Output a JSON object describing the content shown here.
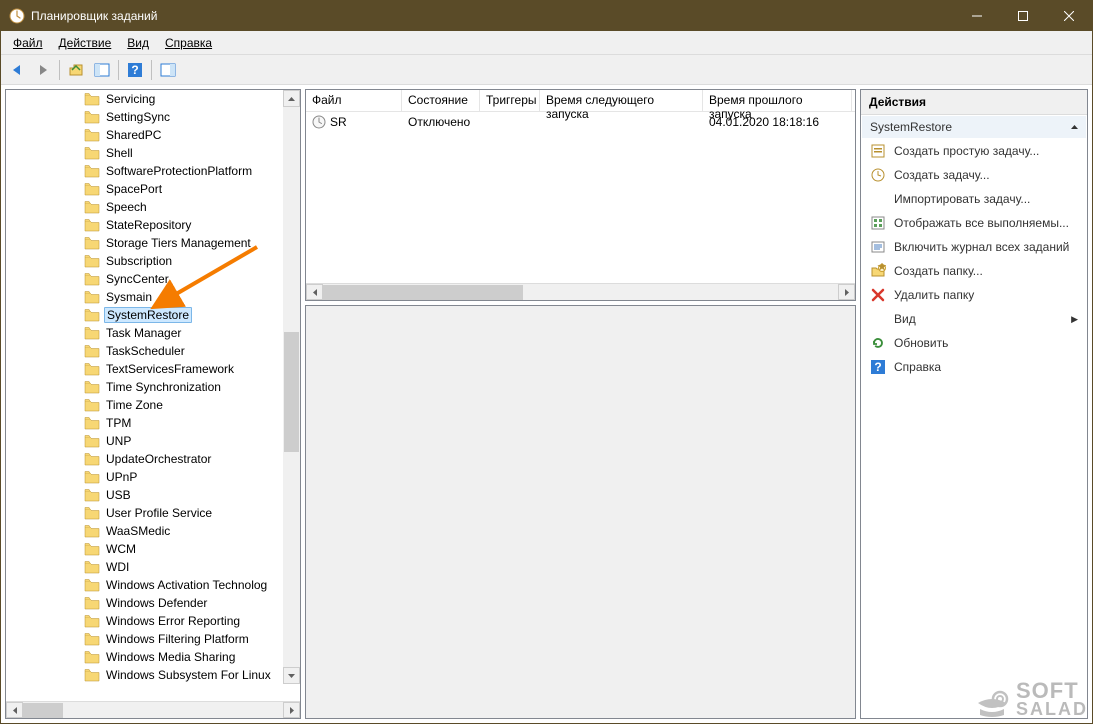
{
  "window": {
    "title": "Планировщик заданий"
  },
  "menu": {
    "items": [
      "Файл",
      "Действие",
      "Вид",
      "Справка"
    ]
  },
  "tree": {
    "items": [
      {
        "label": "Servicing"
      },
      {
        "label": "SettingSync"
      },
      {
        "label": "SharedPC"
      },
      {
        "label": "Shell"
      },
      {
        "label": "SoftwareProtectionPlatform"
      },
      {
        "label": "SpacePort"
      },
      {
        "label": "Speech"
      },
      {
        "label": "StateRepository"
      },
      {
        "label": "Storage Tiers Management"
      },
      {
        "label": "Subscription"
      },
      {
        "label": "SyncCenter"
      },
      {
        "label": "Sysmain"
      },
      {
        "label": "SystemRestore",
        "selected": true
      },
      {
        "label": "Task Manager"
      },
      {
        "label": "TaskScheduler"
      },
      {
        "label": "TextServicesFramework"
      },
      {
        "label": "Time Synchronization"
      },
      {
        "label": "Time Zone"
      },
      {
        "label": "TPM"
      },
      {
        "label": "UNP"
      },
      {
        "label": "UpdateOrchestrator"
      },
      {
        "label": "UPnP"
      },
      {
        "label": "USB"
      },
      {
        "label": "User Profile Service"
      },
      {
        "label": "WaaSMedic"
      },
      {
        "label": "WCM"
      },
      {
        "label": "WDI"
      },
      {
        "label": "Windows Activation Technolog"
      },
      {
        "label": "Windows Defender"
      },
      {
        "label": "Windows Error Reporting"
      },
      {
        "label": "Windows Filtering Platform"
      },
      {
        "label": "Windows Media Sharing"
      },
      {
        "label": "Windows Subsystem For Linux"
      }
    ]
  },
  "tasklist": {
    "columns": [
      {
        "label": "Файл",
        "width": 96
      },
      {
        "label": "Состояние",
        "width": 78
      },
      {
        "label": "Триггеры",
        "width": 60
      },
      {
        "label": "Время следующего запуска",
        "width": 163
      },
      {
        "label": "Время прошлого запуска",
        "width": 149
      }
    ],
    "rows": [
      {
        "name": "SR",
        "state": "Отключено",
        "triggers": "",
        "next": "",
        "last": "04.01.2020 18:18:16"
      }
    ]
  },
  "actions": {
    "header": "Действия",
    "group": "SystemRestore",
    "items": [
      {
        "icon": "create-basic",
        "label": "Создать простую задачу..."
      },
      {
        "icon": "create",
        "label": "Создать задачу..."
      },
      {
        "icon": "import",
        "label": "Импортировать задачу..."
      },
      {
        "icon": "display-all",
        "label": "Отображать все выполняемы..."
      },
      {
        "icon": "enable-history",
        "label": "Включить журнал всех заданий"
      },
      {
        "icon": "new-folder",
        "label": "Создать папку..."
      },
      {
        "icon": "delete",
        "label": "Удалить папку"
      },
      {
        "icon": "view",
        "label": "Вид",
        "submenu": true
      },
      {
        "icon": "refresh",
        "label": "Обновить"
      },
      {
        "icon": "help",
        "label": "Справка"
      }
    ]
  },
  "watermark": {
    "line1": "SOFT",
    "line2": "SALAD"
  }
}
